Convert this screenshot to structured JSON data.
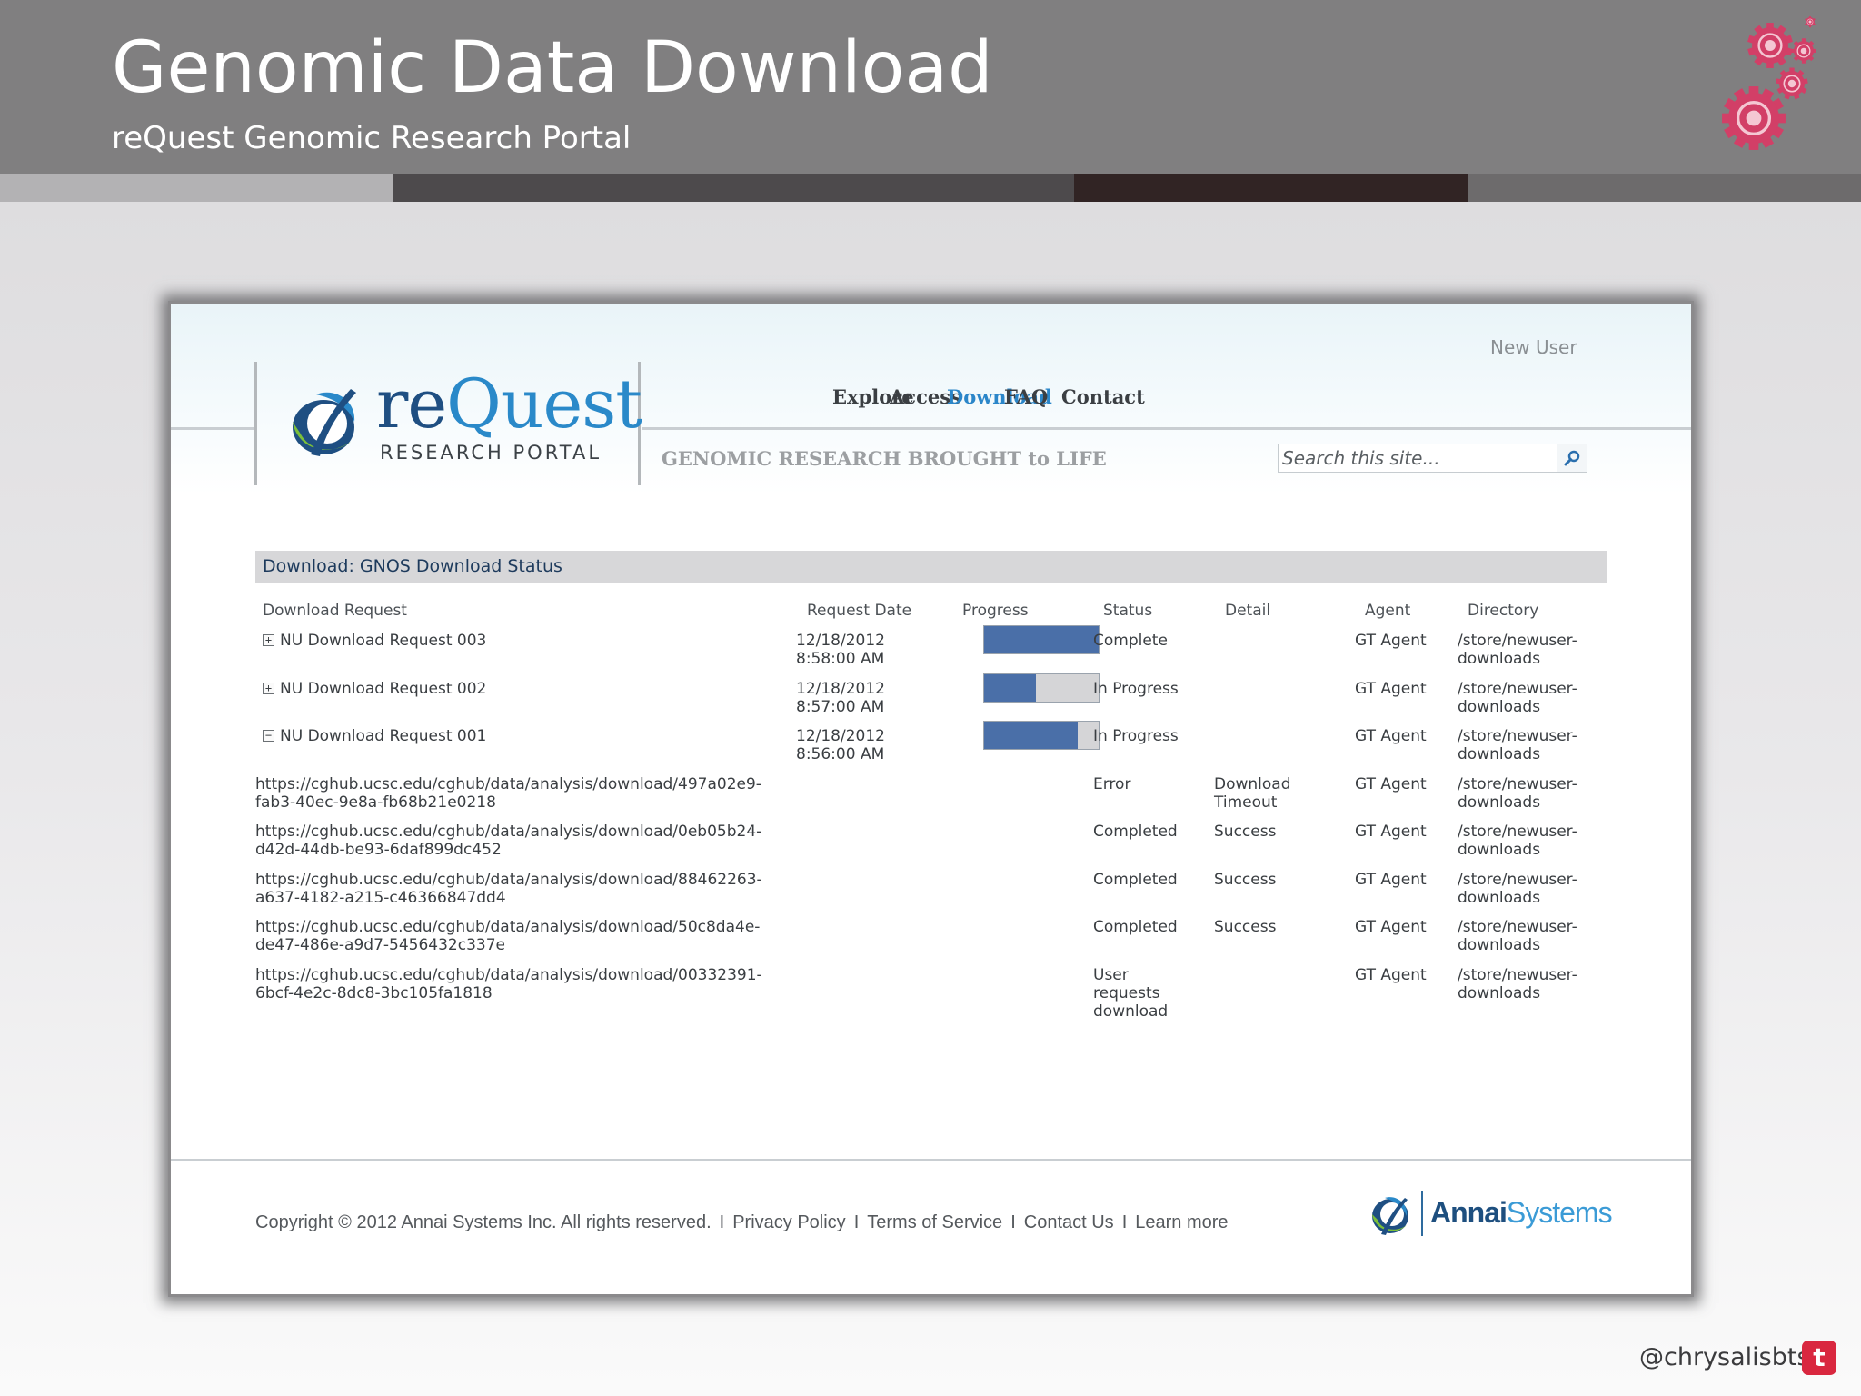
{
  "slide": {
    "title": "Genomic Data Download",
    "subtitle": "reQuest Genomic Research Portal",
    "band_colors": [
      "#b3b2b4",
      "#4d4a4c",
      "#312424",
      "#6d6b6c"
    ],
    "gear_color": "#d23f67",
    "credit": "@chrysalisbts",
    "credit_icon": "t"
  },
  "site": {
    "new_user": "New User",
    "logo": {
      "wordmark_pre": "re",
      "wordmark_post": "Quest",
      "subtitle": "RESEARCH PORTAL"
    },
    "nav": [
      "Explore",
      "Access",
      "Download",
      "FAQ",
      "Contact"
    ],
    "active_nav": "Download",
    "tagline": "GENOMIC RESEARCH BROUGHT to LIFE",
    "search": {
      "placeholder": "Search this site..."
    },
    "colors": {
      "accent": "#2b86c9",
      "progress": "#4a6fa8",
      "header_bar": "#d7d7d9"
    }
  },
  "download_panel": {
    "title": "Download: GNOS Download Status",
    "columns": [
      "Download Request",
      "Request Date",
      "Progress",
      "Status",
      "Detail",
      "Agent",
      "Directory"
    ],
    "requests": [
      {
        "toggle": "+",
        "name": "NU Download Request 003",
        "date": "12/18/2012",
        "time": "8:58:00 AM",
        "progress": 1.0,
        "status": "Complete",
        "detail": "",
        "agent": "GT Agent",
        "dir_line1": "/store/newuser-",
        "dir_line2": "downloads"
      },
      {
        "toggle": "+",
        "name": "NU Download Request 002",
        "date": "12/18/2012",
        "time": "8:57:00 AM",
        "progress": 0.45,
        "status": "In Progress",
        "detail": "",
        "agent": "GT Agent",
        "dir_line1": "/store/newuser-",
        "dir_line2": "downloads"
      },
      {
        "toggle": "−",
        "name": "NU Download Request 001",
        "date": "12/18/2012",
        "time": "8:56:00 AM",
        "progress": 0.82,
        "status": "In Progress",
        "detail": "",
        "agent": "GT Agent",
        "dir_line1": "/store/newuser-",
        "dir_line2": "downloads"
      }
    ],
    "files": [
      {
        "url_line1": "https://cghub.ucsc.edu/cghub/data/analysis/download/497a02e9-",
        "url_line2": "fab3-40ec-9e8a-fb68b21e0218",
        "status_lines": [
          "Error"
        ],
        "detail_lines": [
          "Download",
          "Timeout"
        ],
        "agent": "GT Agent",
        "dir_line1": "/store/newuser-",
        "dir_line2": "downloads"
      },
      {
        "url_line1": "https://cghub.ucsc.edu/cghub/data/analysis/download/0eb05b24-",
        "url_line2": "d42d-44db-be93-6daf899dc452",
        "status_lines": [
          "Completed"
        ],
        "detail_lines": [
          "Success"
        ],
        "agent": "GT Agent",
        "dir_line1": "/store/newuser-",
        "dir_line2": "downloads"
      },
      {
        "url_line1": "https://cghub.ucsc.edu/cghub/data/analysis/download/88462263-",
        "url_line2": "a637-4182-a215-c46366847dd4",
        "status_lines": [
          "Completed"
        ],
        "detail_lines": [
          "Success"
        ],
        "agent": "GT Agent",
        "dir_line1": "/store/newuser-",
        "dir_line2": "downloads"
      },
      {
        "url_line1": "https://cghub.ucsc.edu/cghub/data/analysis/download/50c8da4e-",
        "url_line2": "de47-486e-a9d7-5456432c337e",
        "status_lines": [
          "Completed"
        ],
        "detail_lines": [
          "Success"
        ],
        "agent": "GT Agent",
        "dir_line1": "/store/newuser-",
        "dir_line2": "downloads"
      },
      {
        "url_line1": "https://cghub.ucsc.edu/cghub/data/analysis/download/00332391-",
        "url_line2": "6bcf-4e2c-8dc8-3bc105fa1818",
        "status_lines": [
          "User",
          "requests",
          "download"
        ],
        "detail_lines": [],
        "agent": "GT Agent",
        "dir_line1": "/store/newuser-",
        "dir_line2": "downloads"
      }
    ]
  },
  "footer": {
    "copyright": "Copyright © 2012 Annai Systems Inc. All rights reserved.",
    "links": [
      "Privacy Policy",
      "Terms of Service",
      "Contact Us",
      "Learn more"
    ],
    "separator": "I",
    "brand_bold": "Annai",
    "brand_light": "Systems"
  }
}
